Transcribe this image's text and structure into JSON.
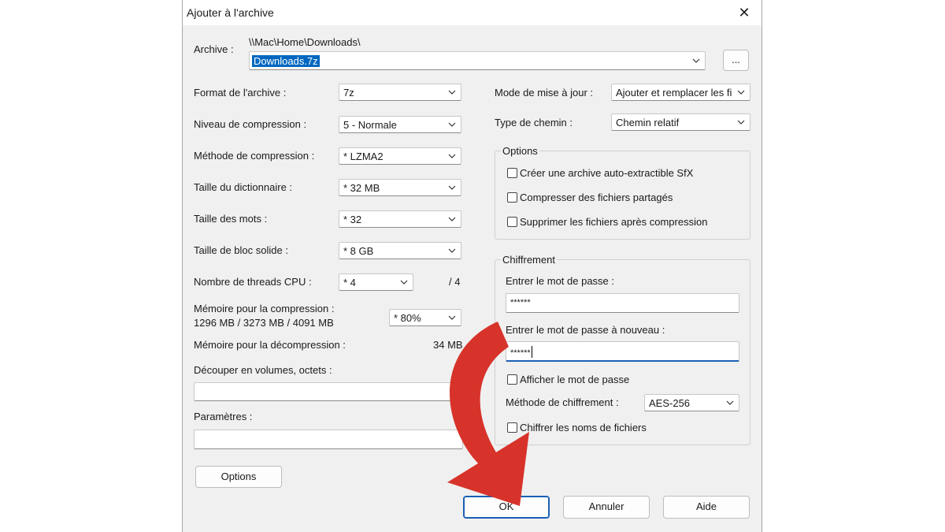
{
  "window": {
    "title": "Ajouter à l'archive"
  },
  "archive": {
    "label": "Archive :",
    "path": "\\\\Mac\\Home\\Downloads\\",
    "filename": "Downloads.7z",
    "browse_label": "..."
  },
  "left": {
    "format": {
      "label": "Format de l'archive :",
      "value": "7z"
    },
    "level": {
      "label": "Niveau de compression :",
      "value": "5 - Normale"
    },
    "method": {
      "label": "Méthode de compression :",
      "value": "*  LZMA2"
    },
    "dict": {
      "label": "Taille du dictionnaire :",
      "value": "*  32 MB"
    },
    "word": {
      "label": "Taille des mots :",
      "value": "*  32"
    },
    "solid": {
      "label": "Taille de bloc solide :",
      "value": "*  8 GB"
    },
    "threads": {
      "label": "Nombre de threads CPU :",
      "value": "*  4",
      "max": "/ 4"
    },
    "memory": {
      "label1": "Mémoire pour la compression :",
      "label2": "1296 MB / 3273 MB / 4091 MB",
      "value": "*  80%"
    },
    "decomp": {
      "label": "Mémoire pour la décompression :",
      "value": "34 MB"
    },
    "split": {
      "label": "Découper en volumes, octets :",
      "value": ""
    },
    "params": {
      "label": "Paramètres :",
      "value": ""
    },
    "options_button": "Options"
  },
  "right": {
    "update": {
      "label": "Mode de mise à jour :",
      "value": "Ajouter et remplacer les fich"
    },
    "pathtype": {
      "label": "Type de chemin :",
      "value": "Chemin relatif"
    },
    "options": {
      "title": "Options",
      "items": [
        "Créer une archive auto-extractible SfX",
        "Compresser des fichiers partagés",
        "Supprimer les fichiers après compression"
      ]
    },
    "encryption": {
      "title": "Chiffrement",
      "password_label": "Entrer le mot de passe :",
      "password_value": "******",
      "password2_label": "Entrer le mot de passe à nouveau :",
      "password2_value": "******",
      "show_password": "Afficher le mot de passe",
      "method_label": "Méthode de chiffrement :",
      "method_value": "AES-256",
      "encrypt_names": "Chiffrer les noms de fichiers"
    }
  },
  "footer": {
    "ok": "OK",
    "cancel": "Annuler",
    "help": "Aide"
  },
  "colors": {
    "arrow": "#d7332a",
    "selection": "#0067c0",
    "focus": "#1a5fb4"
  }
}
